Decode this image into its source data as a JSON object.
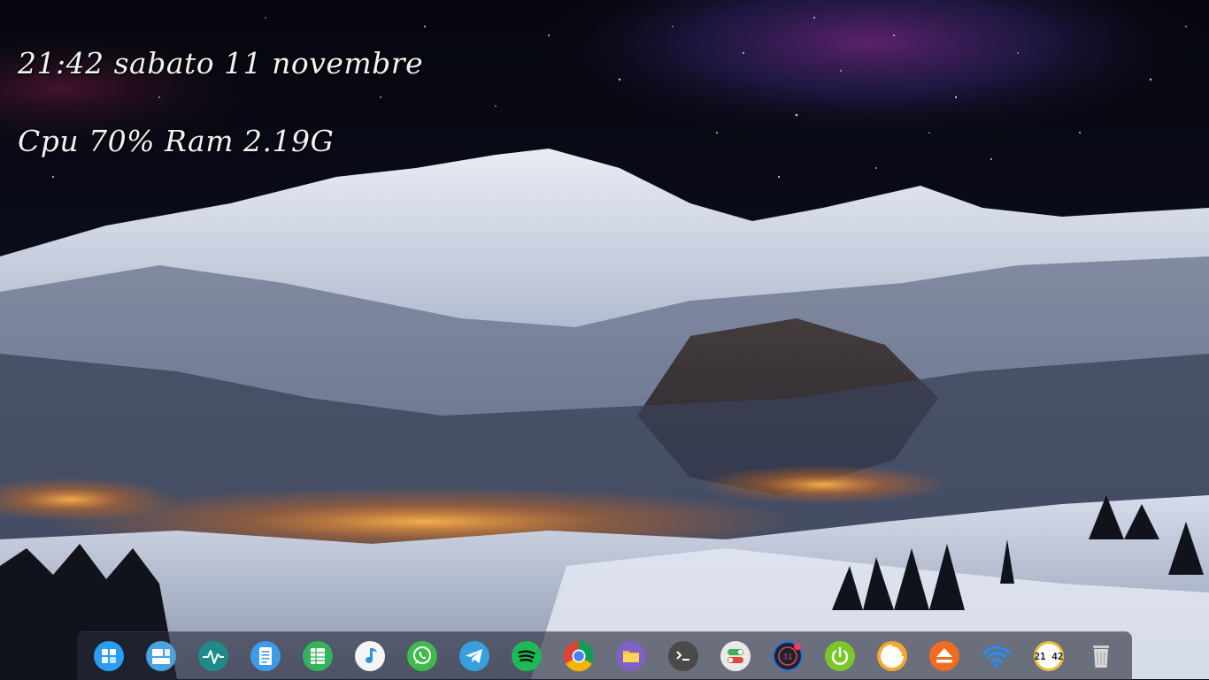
{
  "desktop": {
    "conky_clock": "21:42 sabato 11 novembre",
    "conky_stats": "Cpu 70% Ram 2.19G"
  },
  "dock": {
    "items": [
      {
        "icon": "launcher-icon",
        "color": "#2a9df4"
      },
      {
        "icon": "multitasking-view-icon",
        "color": "#4aa3df"
      },
      {
        "icon": "system-monitor-icon",
        "color": "#1f8a8a"
      },
      {
        "icon": "text-editor-icon",
        "color": "#3d9be9"
      },
      {
        "icon": "spreadsheet-icon",
        "color": "#34b35a"
      },
      {
        "icon": "music-player-icon",
        "color": "#f4f4f4"
      },
      {
        "icon": "whatsapp-icon",
        "color": "#3fba4b"
      },
      {
        "icon": "telegram-icon",
        "color": "#37a0dd"
      },
      {
        "icon": "spotify-icon",
        "color": "#1db954"
      },
      {
        "icon": "chrome-icon",
        "color": "#db4437"
      },
      {
        "icon": "file-manager-icon",
        "color": "#7d62c4"
      },
      {
        "icon": "terminal-icon",
        "color": "#4a4a4a"
      },
      {
        "icon": "settings-toggle-icon",
        "color": "#e9e9e9"
      },
      {
        "icon": "calendar-icon",
        "color": "#2a6fd6",
        "badge": "31"
      },
      {
        "icon": "power-icon",
        "color": "#7ac72a"
      },
      {
        "icon": "clock-applet-icon",
        "color": "#f7a631"
      },
      {
        "icon": "eject-drive-icon",
        "color": "#f26b22"
      },
      {
        "icon": "wifi-icon",
        "color": "#1e90ff"
      },
      {
        "icon": "clock-icon",
        "color": "#e9c03a",
        "label": "21 42"
      },
      {
        "icon": "trash-icon",
        "color": "#d8d8d8"
      }
    ]
  }
}
